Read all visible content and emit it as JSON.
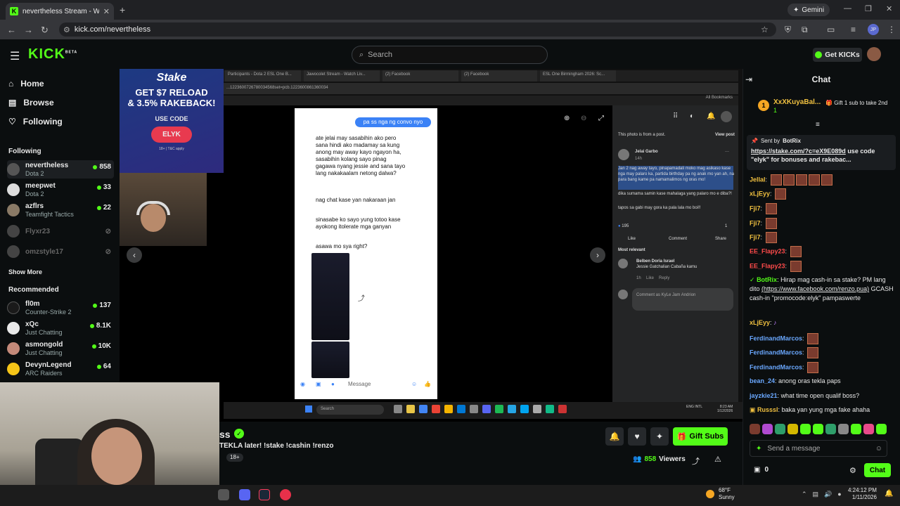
{
  "browser": {
    "tab_title": "nevertheless Stream - Watch Liv...",
    "url": "kick.com/nevertheless",
    "gemini_label": "Gemini",
    "profile_initials": "JP"
  },
  "header": {
    "logo": "KICK",
    "logo_badge": "BETA",
    "search_placeholder": "Search",
    "get_kicks": "Get KICKs"
  },
  "sidebar": {
    "nav": [
      {
        "label": "Home",
        "icon": "home-icon"
      },
      {
        "label": "Browse",
        "icon": "browse-icon"
      },
      {
        "label": "Following",
        "icon": "heart-icon"
      }
    ],
    "following_title": "Following",
    "following": [
      {
        "name": "nevertheless",
        "game": "Dota 2",
        "viewers": "858",
        "live": true
      },
      {
        "name": "meepwet",
        "game": "Dota 2",
        "viewers": "33",
        "live": true
      },
      {
        "name": "azflrs",
        "game": "Teamfight Tactics",
        "viewers": "22",
        "live": true
      },
      {
        "name": "Flyxr23",
        "game": "",
        "viewers": "",
        "live": false
      },
      {
        "name": "omzstyle17",
        "game": "",
        "viewers": "",
        "live": false
      }
    ],
    "show_more": "Show More",
    "recommended_title": "Recommended",
    "recommended": [
      {
        "name": "fl0m",
        "game": "Counter-Strike 2",
        "viewers": "137"
      },
      {
        "name": "xQc",
        "game": "Just Chatting",
        "viewers": "8.1K"
      },
      {
        "name": "asmongold",
        "game": "Just Chatting",
        "viewers": "10K"
      },
      {
        "name": "DevynLegend",
        "game": "ARC Raiders",
        "viewers": "64"
      }
    ]
  },
  "ad": {
    "brand": "Stake",
    "line1": "GET $7 RELOAD",
    "line2": "& 3.5% RAKEBACK!",
    "use_code": "USE CODE",
    "code": "ELYK",
    "fine": "18+ | T&C apply"
  },
  "screenshare": {
    "tabs": [
      "Participants - Dota 2 ESL One B...",
      "Jawocolet Stream - Watch Liv...",
      "(2) Facebook",
      "(2) Facebook",
      "ESL One Birmingham 2026: Sc..."
    ],
    "address": "...1223600726780034568set=pcb.1223600861360034",
    "bookmarks": "All Bookmarks",
    "chat": {
      "me": "pa ss nga ng convo nyo",
      "msg1": "ate jelai may sasabihin ako pero sana hindi ako madamay sa kung anong may away kayo ngayon ha, sasabihin kolang sayo pinag gagawa nyang jessie and sana tayo lang nakakaalam netong dalwa?",
      "msg2": "nag chat kase yan nakaraan jan",
      "msg3": "sinasabe ko sayo yung totoo kase ayokong itolerate mga ganyan",
      "msg4": "asawa mo sya right?",
      "message_placeholder": "Message"
    },
    "fb": {
      "from_post": "This photo is from a post.",
      "view_post": "View post",
      "poster": "Jelai Garbo",
      "post_time": "14h",
      "post_text": "Jan 2 nag away tayo, pinapamadali moko mag asikaso kase nga may palaro ka, partida birthday pa ng anak mo yan ah, na para bang kame pa namamalimos ng oras mo!",
      "post_text2": "dika sumama samin kase mahalaga yang palaro mo e diba?!",
      "post_text3": "tapos sa gabi may gora ka pala lala mo boi!!",
      "reactions": "195",
      "comments_count": "1",
      "like": "Like",
      "comment": "Comment",
      "share": "Share",
      "most_relevant": "Most relevant",
      "commenter": "Belben Doria Israel",
      "comment_text": "Jessie Gatchalian Cabaña kamu",
      "comment_time": "1h",
      "comment_like": "Like",
      "comment_reply": "Reply",
      "comment_as": "Comment as KyLe Jam Andrion"
    },
    "taskbar": {
      "search": "Search",
      "lang": "ENG INTL",
      "time": "8:23 AM",
      "date": "1/12/2026"
    }
  },
  "stream": {
    "name": "ss",
    "title": "TEKLA later! !stake !cashin !renzo",
    "age": "18+",
    "gift_subs": "Gift Subs",
    "viewers": "858",
    "viewers_label": "Viewers"
  },
  "chat": {
    "title": "Chat",
    "top_gifter": "XxXKuyaBal...",
    "top_gifter_count": "1",
    "top_gifter_rank": "1",
    "gift_prompt": "Gift 1 sub to take 2nd",
    "pinned_by_label": "Sent by",
    "pinned_by": "BotRix",
    "pinned_link": "https://stake.com/?c=eX9E089d",
    "pinned_text": " use code \"elyk\" for bonuses and rakebac...",
    "messages": [
      {
        "user": "Jellal",
        "text": "",
        "color": "#f0c040",
        "emotes": 5
      },
      {
        "user": "xLjEyy",
        "text": "",
        "color": "#f0c040",
        "emotes": 1
      },
      {
        "user": "Fji7",
        "text": "",
        "color": "#f0c040",
        "emotes": 1
      },
      {
        "user": "Fji7",
        "text": "",
        "color": "#f0c040",
        "emotes": 1
      },
      {
        "user": "Fji7",
        "text": "",
        "color": "#f0c040",
        "emotes": 1
      },
      {
        "user": "EE_Flapy23",
        "text": "",
        "color": "#ff4b4b",
        "emotes": 1
      },
      {
        "user": "EE_Flapy23",
        "text": "",
        "color": "#ff4b4b",
        "emotes": 1
      },
      {
        "user": "BotRix",
        "text": "Hirap mag cash-in sa stake? PM lang dito",
        "color": "#53fc18",
        "emotes": 0
      },
      {
        "user": "xLjEyy",
        "text": "",
        "color": "#f0c040",
        "emotes": 0
      },
      {
        "user": "FerdinandMarcos",
        "text": "",
        "color": "#6aa8ff",
        "emotes": 1
      },
      {
        "user": "FerdinandMarcos",
        "text": "",
        "color": "#6aa8ff",
        "emotes": 1
      },
      {
        "user": "FerdinandMarcos",
        "text": "",
        "color": "#6aa8ff",
        "emotes": 1
      },
      {
        "user": "bean_24",
        "text": "anong oras tekla paps",
        "color": "#6aa8ff",
        "emotes": 0
      },
      {
        "user": "jayzkie21",
        "text": "what time open qualif boss?",
        "color": "#6aa8ff",
        "emotes": 0
      },
      {
        "user": "Russsl",
        "text": "baka yan yung mga fake ahaha",
        "color": "#f0c040",
        "emotes": 0
      }
    ],
    "botrix_link": "(https://www.facebook.com/renzo.pua)",
    "botrix_tail": " GCASH cash-in \"promocode:elyk\" pampaswerte",
    "send_placeholder": "Send a message",
    "kicks_count": "0",
    "chat_button": "Chat"
  },
  "os_taskbar": {
    "temp": "68°F",
    "weather": "Sunny",
    "time": "4:24:12 PM",
    "date": "1/11/2026"
  },
  "colors": {
    "accent": "#53fc18",
    "bg": "#0b0e0f"
  }
}
